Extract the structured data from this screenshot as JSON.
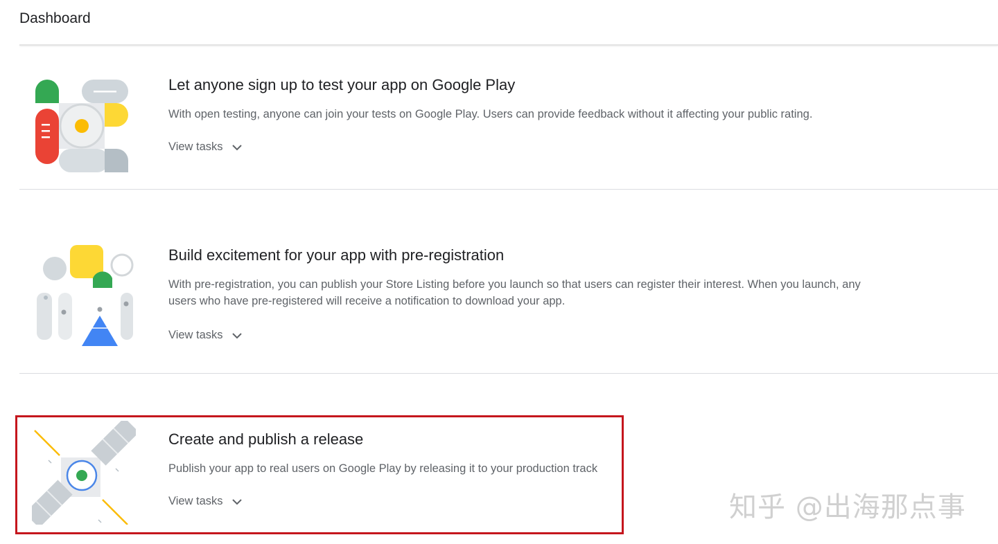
{
  "header": {
    "title": "Dashboard"
  },
  "cards": [
    {
      "title": "Let anyone sign up to test your app on Google Play",
      "description": "With open testing, anyone can join your tests on Google Play. Users can provide feedback without it affecting your public rating.",
      "action_label": "View tasks"
    },
    {
      "title": "Build excitement for your app with pre-registration",
      "description": "With pre-registration, you can publish your Store Listing before you launch so that users can register their interest. When you launch, any users who have pre-registered will receive a notification to download your app.",
      "action_label": "View tasks"
    },
    {
      "title": "Create and publish a release",
      "description": "Publish your app to real users on Google Play by releasing it to your production track",
      "action_label": "View tasks"
    }
  ],
  "watermark": {
    "text": "知乎 @出海那点事"
  },
  "colors": {
    "highlight": "#c5161d",
    "google_green": "#34a853",
    "google_red": "#ea4335",
    "google_yellow": "#fdd835",
    "google_blue": "#4285f4"
  }
}
